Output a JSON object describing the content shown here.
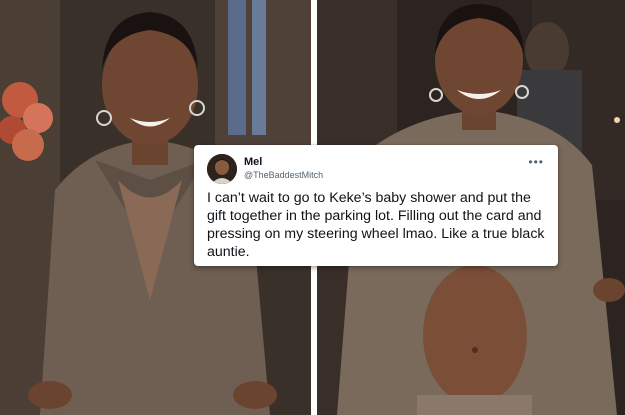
{
  "tweet": {
    "display_name": "Mel",
    "handle": "@TheBaddestMitch",
    "text": "I can’t wait to go to Keke’s baby shower and put the gift together in the parking lot. Filling out the card and pressing on my steering wheel lmao. Like a true black auntie.",
    "more_icon": "more-horizontal-icon"
  },
  "colors": {
    "suit": "#6e5f52",
    "background_dark": "#2a2320",
    "card_bg": "#ffffff",
    "divider": "#ffffff"
  }
}
